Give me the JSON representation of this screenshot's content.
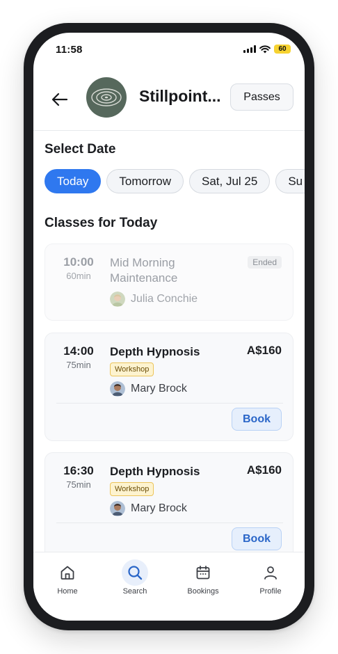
{
  "status": {
    "time": "11:58",
    "battery": "60"
  },
  "header": {
    "studio_name": "Stillpoint...",
    "passes_label": "Passes"
  },
  "date_section": {
    "title": "Select Date",
    "chips": [
      "Today",
      "Tomorrow",
      "Sat, Jul 25",
      "Su"
    ],
    "selected": "Today"
  },
  "classes_section": {
    "title": "Classes for Today"
  },
  "classes": [
    {
      "time": "10:00",
      "duration": "60min",
      "name": "Mid Morning Maintenance",
      "status": "Ended",
      "instructor": "Julia Conchie"
    },
    {
      "time": "14:00",
      "duration": "75min",
      "name": "Depth Hypnosis",
      "price": "A$160",
      "tag": "Workshop",
      "instructor": "Mary Brock",
      "action": "Book"
    },
    {
      "time": "16:30",
      "duration": "75min",
      "name": "Depth Hypnosis",
      "price": "A$160",
      "tag": "Workshop",
      "instructor": "Mary Brock",
      "action": "Book"
    }
  ],
  "tabs": [
    {
      "label": "Home",
      "icon": "home-icon"
    },
    {
      "label": "Search",
      "icon": "search-icon",
      "active": true
    },
    {
      "label": "Bookings",
      "icon": "calendar-icon"
    },
    {
      "label": "Profile",
      "icon": "user-icon"
    }
  ],
  "colors": {
    "accent": "#2f78ef",
    "logo_bg": "#56685c",
    "tag_bg": "#fdf3cf",
    "book_bg": "#e6effc"
  }
}
